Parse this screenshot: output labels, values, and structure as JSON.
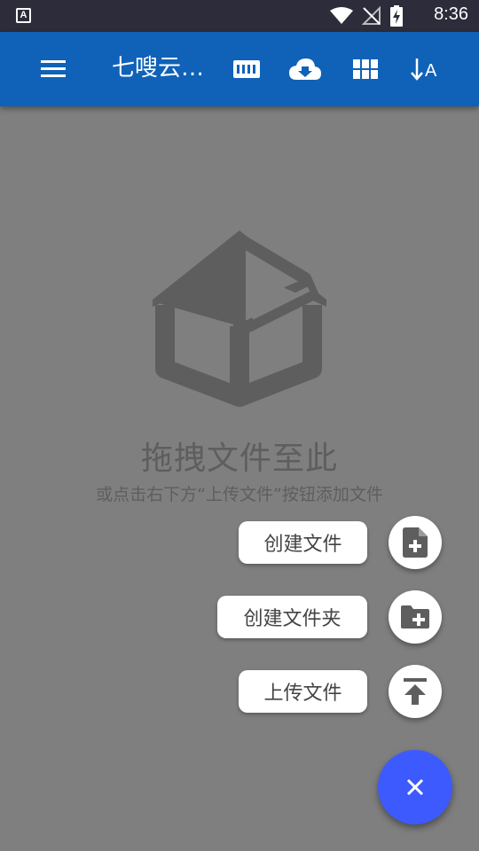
{
  "status_bar": {
    "notification_icon": "A",
    "time": "8:36",
    "icons": [
      "wifi-icon",
      "no-signal-icon",
      "battery-charging-icon"
    ]
  },
  "app_bar": {
    "title": "七嗖云…",
    "actions": [
      "storage-icon",
      "cloud-download-icon",
      "grid-view-icon",
      "sort-alpha-icon"
    ],
    "sort_label": "A"
  },
  "empty_state": {
    "icon": "open-box-icon",
    "title": "拖拽文件至此",
    "subtitle": "或点击右下方“上传文件”按钮添加文件"
  },
  "fab_menu": {
    "items": [
      {
        "label": "创建文件",
        "icon": "note-add-icon"
      },
      {
        "label": "创建文件夹",
        "icon": "create-folder-icon"
      },
      {
        "label": "上传文件",
        "icon": "upload-icon"
      }
    ],
    "close_icon": "close-icon"
  },
  "colors": {
    "status_bar": "#2c2c3a",
    "app_bar": "#0f62b8",
    "scrim": "#7f7f7f",
    "fab": "#3d5afe"
  }
}
